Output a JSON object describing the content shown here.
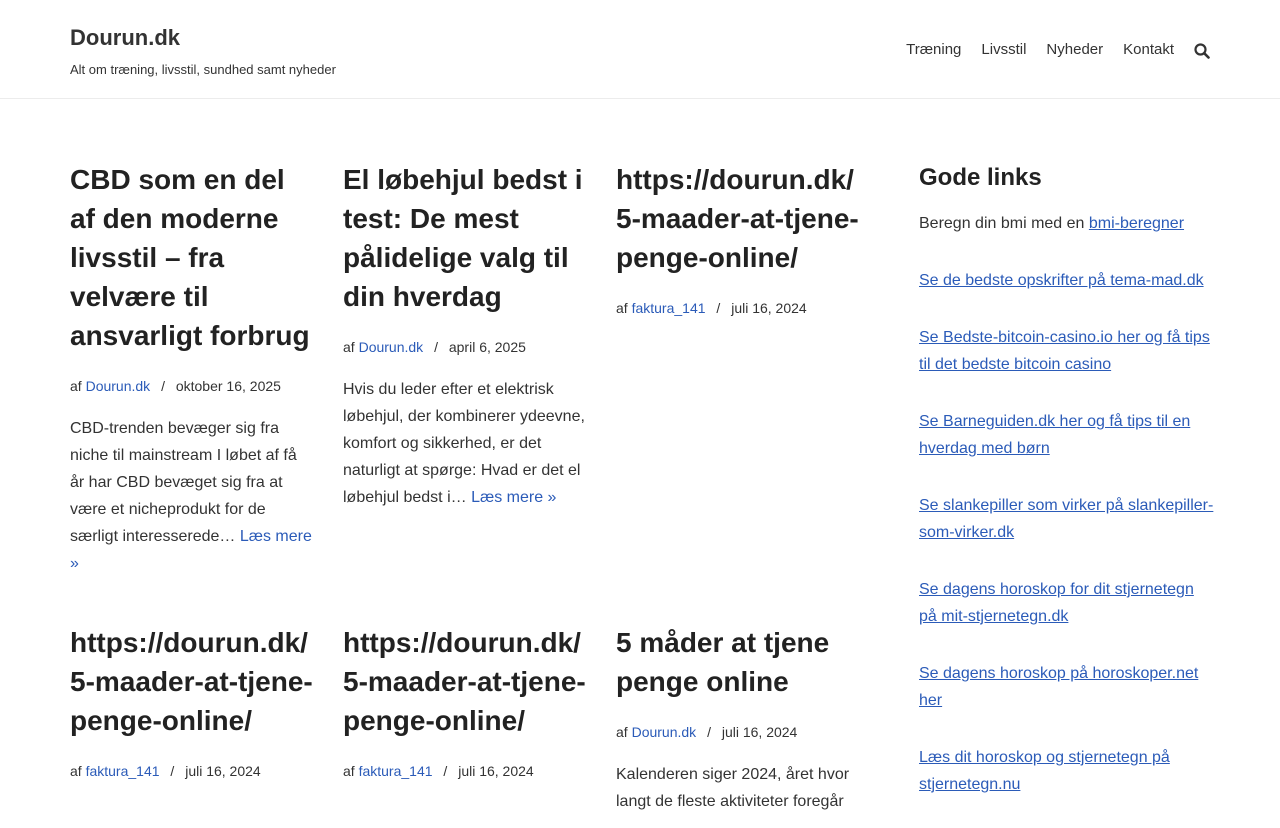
{
  "header": {
    "site_title": "Dourun.dk",
    "tagline": "Alt om træning, livsstil, sundhed samt nyheder",
    "nav": [
      "Træning",
      "Livsstil",
      "Nyheder",
      "Kontakt"
    ]
  },
  "posts": [
    {
      "title": "CBD som en del af den moderne livsstil – fra velvære til ansvarligt forbrug",
      "by": "af",
      "author": "Dourun.dk",
      "sep": "/",
      "date": "oktober 16, 2025",
      "excerpt": "CBD-trenden bevæger sig fra niche til mainstream I løbet af få år har CBD bevæget sig fra at være et nicheprodukt for de særligt interesserede…",
      "read_more": "Læs mere »"
    },
    {
      "title": "El løbehjul bedst i test: De mest pålidelige valg til din hverdag",
      "by": "af",
      "author": "Dourun.dk",
      "sep": "/",
      "date": "april 6, 2025",
      "excerpt": "Hvis du leder efter et elektrisk løbehjul, der kombinerer ydeevne, komfort og sikkerhed, er det naturligt at spørge: Hvad er det el løbehjul bedst i…",
      "read_more": "Læs mere »"
    },
    {
      "title": "https://dourun.dk/ 5-maader-at-tjene-penge-online/",
      "by": "af",
      "author": "faktura_141",
      "sep": "/",
      "date": "juli 16, 2024"
    },
    {
      "title": "https://dourun.dk/ 5-maader-at-tjene-penge-online/",
      "by": "af",
      "author": "faktura_141",
      "sep": "/",
      "date": "juli 16, 2024"
    },
    {
      "title": "https://dourun.dk/ 5-maader-at-tjene-penge-online/",
      "by": "af",
      "author": "faktura_141",
      "sep": "/",
      "date": "juli 16, 2024"
    },
    {
      "title": "5 måder at tjene penge online",
      "by": "af",
      "author": "Dourun.dk",
      "sep": "/",
      "date": "juli 16, 2024",
      "excerpt": "Kalenderen siger 2024, året hvor langt de fleste aktiviteter foregår"
    }
  ],
  "sidebar": {
    "title": "Gode links",
    "first_prefix": "Beregn din bmi med en ",
    "first_link": "bmi-beregner",
    "links": [
      "Se de bedste opskrifter på tema-mad.dk",
      "Se Bedste-bitcoin-casino.io her og få tips til det bedste bitcoin casino",
      "Se Barneguiden.dk her og få tips til en hverdag med børn",
      "Se slankepiller som virker på slankepiller-som-virker.dk",
      "Se dagens horoskop for dit stjernetegn på mit-stjernetegn.dk",
      "Se dagens horoskop på horoskoper.net her",
      "Læs dit horoskop og stjernetegn på stjernetegn.nu"
    ]
  },
  "colors": {
    "link": "#2b5bb8",
    "heading": "#222222",
    "text": "#333333"
  },
  "icons": {
    "search": "search-icon"
  }
}
